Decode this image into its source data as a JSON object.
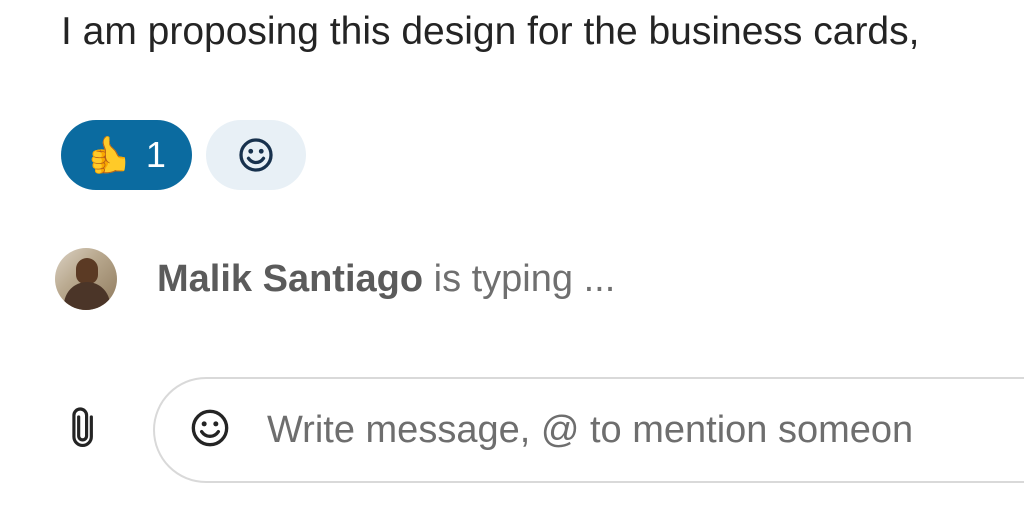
{
  "message": {
    "text": "I am proposing this design for the business cards,"
  },
  "reactions": {
    "thumbsup": {
      "emoji": "👍",
      "count": "1"
    }
  },
  "typing": {
    "name": "Malik Santiago",
    "suffix": " is typing ..."
  },
  "compose": {
    "placeholder": "Write message, @ to mention someon"
  },
  "colors": {
    "reaction_active_bg": "#0b6ba0",
    "reaction_idle_bg": "#e8f0f6",
    "icon": "#242424"
  }
}
